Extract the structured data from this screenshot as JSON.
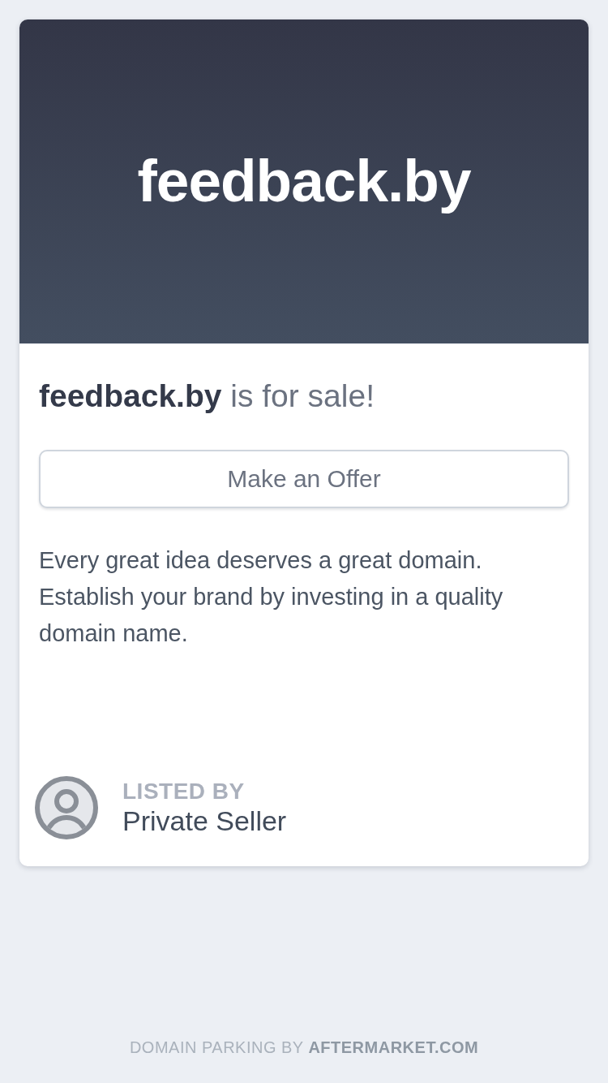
{
  "hero": {
    "domain": "feedback.by"
  },
  "headline": "**feedback.by** is for sale!",
  "offer_button": {
    "label": "Make an Offer"
  },
  "description": "Every great idea deserves a great domain. Establish your brand by investing in a quality domain name.",
  "seller": {
    "label": "LISTED BY",
    "name": "Private Seller"
  },
  "footer": {
    "text": "DOMAIN PARKING BY",
    "link": "AFTERMARKET.COM"
  }
}
